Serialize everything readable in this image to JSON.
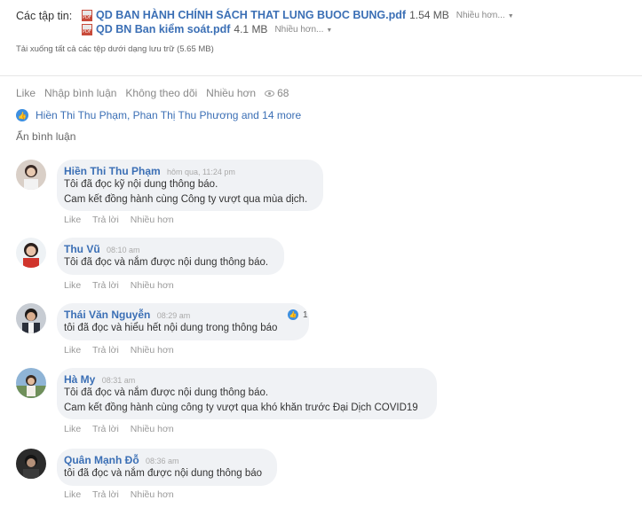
{
  "attachments": {
    "label": "Các tập tin:",
    "files": [
      {
        "name": "QD BAN HÀNH CHÍNH SÁCH THAT LUNG BUOC BUNG.pdf",
        "size": "1.54 MB",
        "more": "Nhiều hơn..."
      },
      {
        "name": "QD BN Ban kiểm soát.pdf",
        "size": "4.1 MB",
        "more": "Nhiều hơn..."
      }
    ],
    "download_all": "Tải xuống tất cả các tệp dưới dạng lưu trữ (5.65 MB)"
  },
  "actions": {
    "like": "Like",
    "comment": "Nhập bình luận",
    "unfollow": "Không theo dõi",
    "more": "Nhiều hơn",
    "views": "68"
  },
  "likers": {
    "text": "Hiền Thi Thu Phạm, Phan Thị Thu Phương and 14 more"
  },
  "hide_comments": "Ẩn bình luận",
  "comments": [
    {
      "name": "Hiền Thi Thu Phạm",
      "time": "hôm qua, 11:24 pm",
      "lines": [
        "Tôi đã đọc kỹ nội dung thông báo.",
        "Cam kết đồng hành cùng Công ty vượt qua mùa dịch."
      ],
      "like": "Like",
      "reply": "Trả lời",
      "more": "Nhiều hơn"
    },
    {
      "name": "Thu Vũ",
      "time": "08:10 am",
      "lines": [
        "Tôi đã đọc và nắm được nội dung thông báo."
      ],
      "like": "Like",
      "reply": "Trả lời",
      "more": "Nhiều hơn"
    },
    {
      "name": "Thái Văn Nguyễn",
      "time": "08:29 am",
      "lines": [
        "tôi đã đọc và hiểu hết nội dung trong thông báo"
      ],
      "like": "Like",
      "reply": "Trả lời",
      "more": "Nhiều hơn",
      "reaction_count": "1"
    },
    {
      "name": "Hà My",
      "time": "08:31 am",
      "lines": [
        "Tôi đã đọc và nắm được nội dung thông báo.",
        "Cam kết đồng hành cùng công ty vượt qua khó khăn trước Đại Dịch COVID19"
      ],
      "like": "Like",
      "reply": "Trả lời",
      "more": "Nhiều hơn"
    },
    {
      "name": "Quân Mạnh Đỗ",
      "time": "08:36 am",
      "lines": [
        "tôi đã đọc và nắm được nội dung thông báo"
      ],
      "like": "Like",
      "reply": "Trả lời",
      "more": "Nhiều hơn"
    }
  ],
  "colors": {
    "link": "#3b6fb5",
    "bubble": "#f0f2f5",
    "like_badge": "#3d8fe0"
  }
}
